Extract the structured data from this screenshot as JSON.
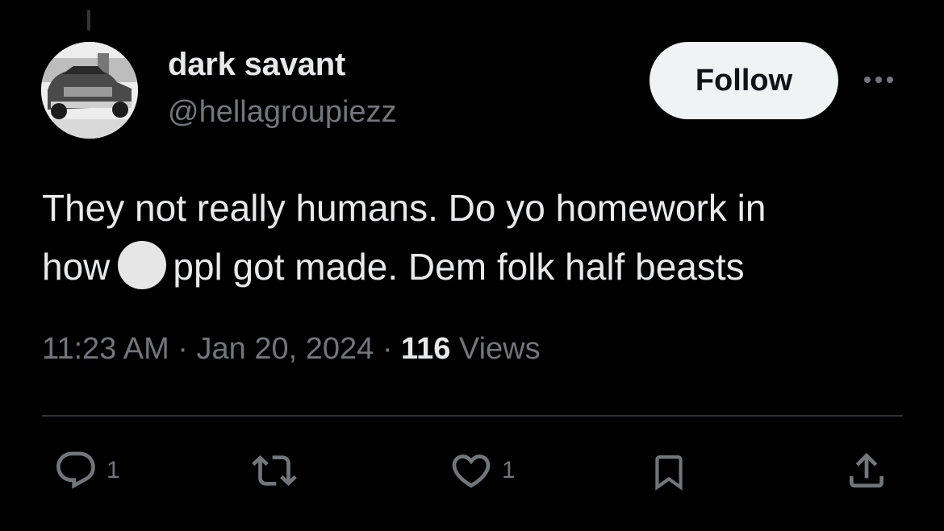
{
  "author": {
    "display_name": "dark savant",
    "handle": "@hellagroupiezz"
  },
  "follow_label": "Follow",
  "tweet": {
    "line1": "They not really humans. Do yo homework in",
    "line2_before": "how",
    "line2_emoji_icon": "white-circle-emoji",
    "line2_after": "ppl got made. Dem folk half beasts"
  },
  "meta": {
    "time": "11:23 AM",
    "separator": "·",
    "date": "Jan 20, 2024",
    "views_count": "116",
    "views_label": "Views"
  },
  "actions": {
    "reply_count": "1",
    "like_count": "1"
  },
  "colors": {
    "background": "#000000",
    "text_primary": "#e7e9ea",
    "text_secondary": "#71767b",
    "divider": "#2f3336",
    "follow_bg": "#eff3f4"
  }
}
